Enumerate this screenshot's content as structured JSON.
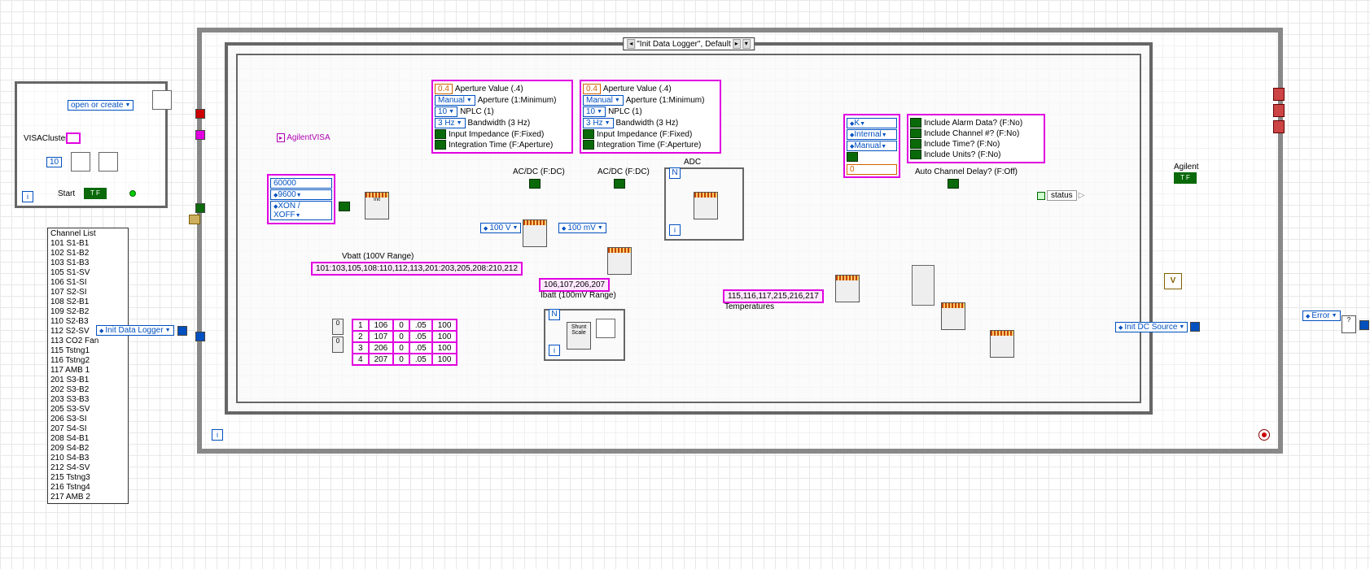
{
  "left_cluster": {
    "open_mode": "open or create",
    "visa_label": "VISACluster",
    "const_10": "10",
    "start_label": "Start"
  },
  "channel_list": {
    "header": "Channel List",
    "items": [
      "101 S1-B1",
      "102 S1-B2",
      "103 S1-B3",
      "105 S1-SV",
      "106 S1-SI",
      "107 S2-SI",
      "108 S2-B1",
      "109 S2-B2",
      "110 S2-B3",
      "112 S2-SV",
      "113 CO2 Fan",
      "115 Tstng1",
      "116 Tstng2",
      "117 AMB 1",
      "201 S3-B1",
      "202 S3-B2",
      "203 S3-B3",
      "205 S3-SV",
      "206 S3-SI",
      "207 S4-SI",
      "208 S4-B1",
      "209 S4-B2",
      "210 S4-B3",
      "212 S4-SV",
      "215 Tstng3",
      "216 Tstng4",
      "217 AMB 2"
    ]
  },
  "init_dl_ring": "Init Data Logger",
  "init_dc_ring": "Init DC Source",
  "error_ring": "Error",
  "case_label": "\"Init Data Logger\", Default",
  "agilent_visa": "AgilentVISA",
  "serial": {
    "timeout": "60000",
    "baud": "9600",
    "flow": "XON / XOFF"
  },
  "cfg1": {
    "aperture_val": "0.4",
    "aperture_val_label": "Aperture Value (.4)",
    "aperture_mode": "Manual",
    "aperture_mode_label": "Aperture (1:Minimum)",
    "nplc": "10",
    "nplc_label": "NPLC (1)",
    "bw": "3 Hz",
    "bw_label": "Bandwidth (3 Hz)",
    "imp_label": "Input Impedance (F:Fixed)",
    "int_label": "Integration Time (F:Aperture)"
  },
  "cfg2": {
    "aperture_val": "0.4",
    "aperture_val_label": "Aperture Value (.4)",
    "aperture_mode": "Manual",
    "aperture_mode_label": "Aperture (1:Minimum)",
    "nplc": "10",
    "nplc_label": "NPLC (1)",
    "bw": "3 Hz",
    "bw_label": "Bandwidth (3 Hz)",
    "imp_label": "Input Impedance (F:Fixed)",
    "int_label": "Integration Time (F:Aperture)"
  },
  "acdc1_label": "AC/DC (F:DC)",
  "acdc2_label": "AC/DC (F:DC)",
  "adc_label": "ADC",
  "range1": "100 V",
  "range2": "100 mV",
  "temp_cfg": {
    "type": "K",
    "ref": "Internal",
    "mode": "Manual",
    "zero": "0"
  },
  "format_opts": {
    "alarm": "Include Alarm Data? (F:No)",
    "chan": "Include Channel #? (F:No)",
    "time": "Include Time? (F:No)",
    "units": "Include Units? (F:No)"
  },
  "auto_delay": "Auto Channel Delay? (F:Off)",
  "status_label": "status",
  "agilent_out": "Agilent",
  "vbatt_label": "Vbatt (100V Range)",
  "vbatt_list": "101:103,105,108:110,112,113,201:203,205,208:210,212",
  "ibatt_list": "106,107,206,207",
  "ibatt_label": "Ibatt (100mV Range)",
  "temp_list": "115,116,117,215,216,217",
  "temp_label": "Temperatures",
  "shunt_label": "Shunt\nScale",
  "shunt_table": {
    "idx0": "0",
    "idx1": "0",
    "rows": [
      [
        "1",
        "106",
        "0",
        ".05",
        "100"
      ],
      [
        "2",
        "107",
        "0",
        ".05",
        "100"
      ],
      [
        "3",
        "206",
        "0",
        ".05",
        "100"
      ],
      [
        "4",
        "207",
        "0",
        ".05",
        "100"
      ]
    ]
  }
}
